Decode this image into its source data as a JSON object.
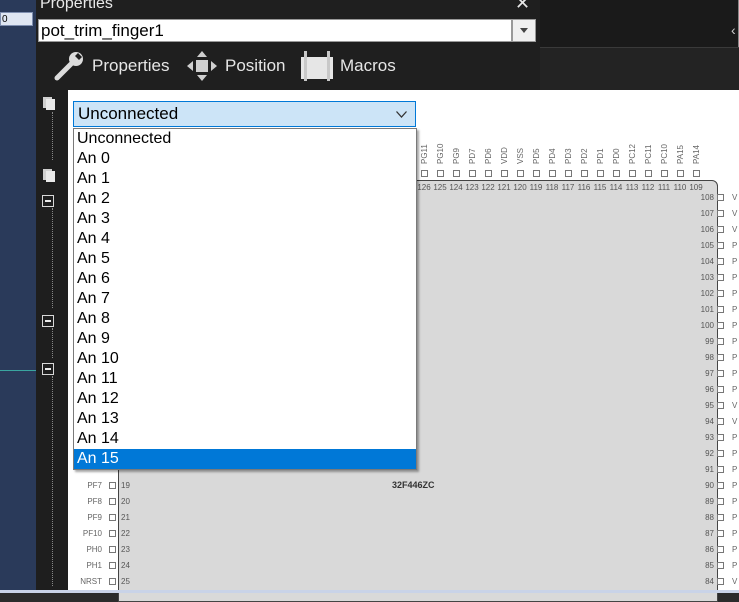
{
  "left_panel": {
    "cell_text": "0"
  },
  "properties_panel": {
    "title": "Properties",
    "close_glyph": "✕",
    "component_name": "pot_trim_finger1",
    "tabs": [
      {
        "label": "Properties",
        "icon": "wrench-icon"
      },
      {
        "label": "Position",
        "icon": "move-arrows-icon"
      },
      {
        "label": "Macros",
        "icon": "macro-bar-icon"
      }
    ]
  },
  "right_panel": {
    "chevron": "‹"
  },
  "dropdown": {
    "selected_value": "Unconnected",
    "options": [
      "Unconnected",
      "An 0",
      "An 1",
      "An 2",
      "An 3",
      "An 4",
      "An 5",
      "An 6",
      "An 7",
      "An 8",
      "An 9",
      "An 10",
      "An 11",
      "An 12",
      "An 13",
      "An 14",
      "An 15"
    ],
    "highlighted_option": "An 15"
  },
  "chip": {
    "part_label": "32F446ZC",
    "top_pins": [
      {
        "name": "PG11",
        "num": "126"
      },
      {
        "name": "PG10",
        "num": "125"
      },
      {
        "name": "PG9",
        "num": "124"
      },
      {
        "name": "PD7",
        "num": "123"
      },
      {
        "name": "PD6",
        "num": "122"
      },
      {
        "name": "VDD",
        "num": "121"
      },
      {
        "name": "VSS",
        "num": "120"
      },
      {
        "name": "PD5",
        "num": "119"
      },
      {
        "name": "PD4",
        "num": "118"
      },
      {
        "name": "PD3",
        "num": "117"
      },
      {
        "name": "PD2",
        "num": "116"
      },
      {
        "name": "PD1",
        "num": "115"
      },
      {
        "name": "PD0",
        "num": "114"
      },
      {
        "name": "PC12",
        "num": "113"
      },
      {
        "name": "PC11",
        "num": "112"
      },
      {
        "name": "PC10",
        "num": "111"
      },
      {
        "name": "PA15",
        "num": "110"
      },
      {
        "name": "PA14",
        "num": "109"
      }
    ],
    "left_pins": [
      {
        "name": "PF7",
        "num": "19"
      },
      {
        "name": "PF8",
        "num": "20"
      },
      {
        "name": "PF9",
        "num": "21"
      },
      {
        "name": "PF10",
        "num": "22"
      },
      {
        "name": "PH0",
        "num": "23"
      },
      {
        "name": "PH1",
        "num": "24"
      },
      {
        "name": "NRST",
        "num": "25"
      }
    ],
    "right_pins": [
      {
        "num": "108",
        "name": "V"
      },
      {
        "num": "107",
        "name": "V"
      },
      {
        "num": "106",
        "name": "V"
      },
      {
        "num": "105",
        "name": "P"
      },
      {
        "num": "104",
        "name": "P"
      },
      {
        "num": "103",
        "name": "P"
      },
      {
        "num": "102",
        "name": "P"
      },
      {
        "num": "101",
        "name": "P"
      },
      {
        "num": "100",
        "name": "P"
      },
      {
        "num": "99",
        "name": "P"
      },
      {
        "num": "98",
        "name": "P"
      },
      {
        "num": "97",
        "name": "P"
      },
      {
        "num": "96",
        "name": "P"
      },
      {
        "num": "95",
        "name": "V"
      },
      {
        "num": "94",
        "name": "V"
      },
      {
        "num": "93",
        "name": "P"
      },
      {
        "num": "92",
        "name": "P"
      },
      {
        "num": "91",
        "name": "P"
      },
      {
        "num": "90",
        "name": "P"
      },
      {
        "num": "89",
        "name": "P"
      },
      {
        "num": "88",
        "name": "P"
      },
      {
        "num": "87",
        "name": "P"
      },
      {
        "num": "86",
        "name": "P"
      },
      {
        "num": "85",
        "name": "P"
      },
      {
        "num": "84",
        "name": "V"
      }
    ]
  }
}
